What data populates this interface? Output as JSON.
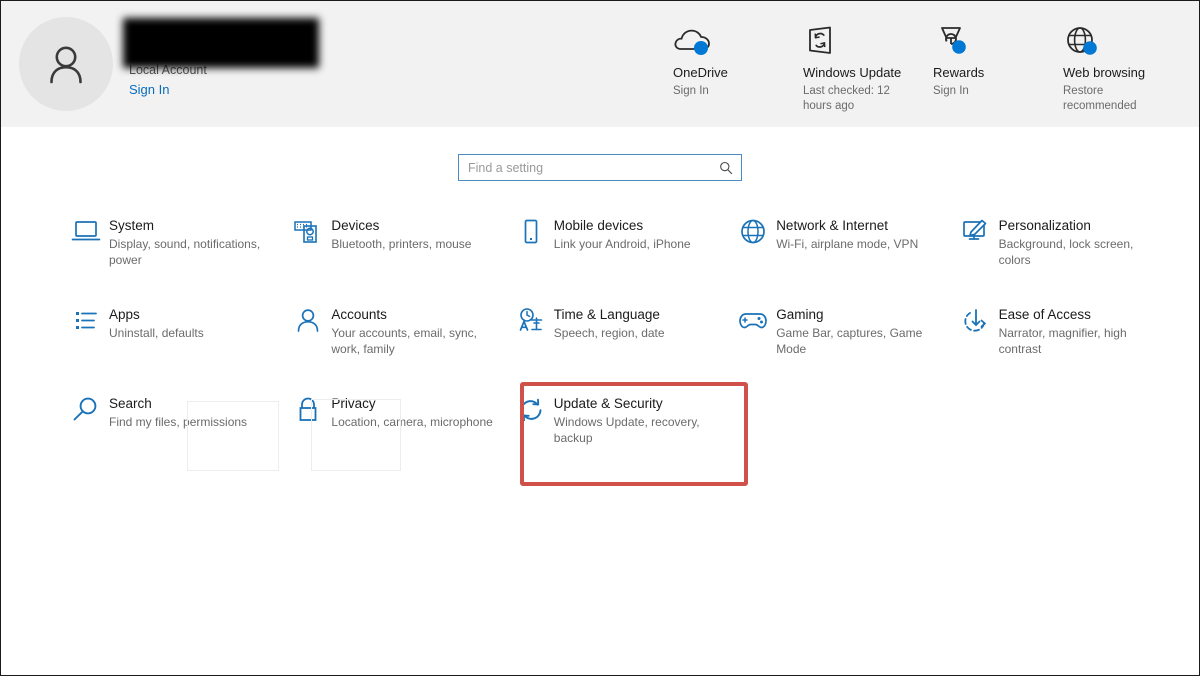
{
  "window": {
    "app_name": "Settings",
    "background": "#ffffff",
    "header_background": "#f2f2f2",
    "accent_color": "#0a6cbc",
    "highlight_color": "#d0504a"
  },
  "account": {
    "name": "",
    "name_redacted": true,
    "type_label": "Local Account",
    "signin_label": "Sign In",
    "avatar_icon": "person-icon"
  },
  "status_items": [
    {
      "icon": "onedrive-cloud-icon",
      "title": "OneDrive",
      "subtitle": "Sign In",
      "badge": "blue-dot"
    },
    {
      "icon": "windows-update-sync-icon",
      "title": "Windows Update",
      "subtitle": "Last checked: 12 hours ago",
      "badge": "blue-dot"
    },
    {
      "icon": "rewards-trophy-icon",
      "title": "Rewards",
      "subtitle": "Sign In",
      "badge": "blue-dot"
    },
    {
      "icon": "web-browsing-globe-icon",
      "title": "Web browsing",
      "subtitle": "Restore recommended",
      "badge": "blue-dot"
    }
  ],
  "search": {
    "placeholder": "Find a setting",
    "value": "",
    "icon": "search-icon"
  },
  "settings_tiles": [
    {
      "id": "system",
      "icon": "laptop-icon",
      "title": "System",
      "subtitle": "Display, sound, notifications, power",
      "highlighted": false
    },
    {
      "id": "devices",
      "icon": "devices-printer-icon",
      "title": "Devices",
      "subtitle": "Bluetooth, printers, mouse",
      "highlighted": false
    },
    {
      "id": "mobile-devices",
      "icon": "phone-icon",
      "title": "Mobile devices",
      "subtitle": "Link your Android, iPhone",
      "highlighted": false
    },
    {
      "id": "network-internet",
      "icon": "globe-icon",
      "title": "Network & Internet",
      "subtitle": "Wi-Fi, airplane mode, VPN",
      "highlighted": false
    },
    {
      "id": "personalization",
      "icon": "monitor-brush-icon",
      "title": "Personalization",
      "subtitle": "Background, lock screen, colors",
      "highlighted": false
    },
    {
      "id": "apps",
      "icon": "app-list-icon",
      "title": "Apps",
      "subtitle": "Uninstall, defaults",
      "highlighted": false
    },
    {
      "id": "accounts",
      "icon": "person-icon",
      "title": "Accounts",
      "subtitle": "Your accounts, email, sync, work, family",
      "highlighted": false
    },
    {
      "id": "time-language",
      "icon": "clock-language-icon",
      "title": "Time & Language",
      "subtitle": "Speech, region, date",
      "highlighted": false
    },
    {
      "id": "gaming",
      "icon": "gamepad-icon",
      "title": "Gaming",
      "subtitle": "Game Bar, captures, Game Mode",
      "highlighted": false
    },
    {
      "id": "ease-of-access",
      "icon": "ease-of-access-icon",
      "title": "Ease of Access",
      "subtitle": "Narrator, magnifier, high contrast",
      "highlighted": false
    },
    {
      "id": "search",
      "icon": "magnifier-icon",
      "title": "Search",
      "subtitle": "Find my files, permissions",
      "highlighted": false
    },
    {
      "id": "privacy",
      "icon": "lock-icon",
      "title": "Privacy",
      "subtitle": "Location, camera, microphone",
      "highlighted": false
    },
    {
      "id": "update-security",
      "icon": "refresh-sync-icon",
      "title": "Update & Security",
      "subtitle": "Windows Update, recovery, backup",
      "highlighted": true
    }
  ]
}
